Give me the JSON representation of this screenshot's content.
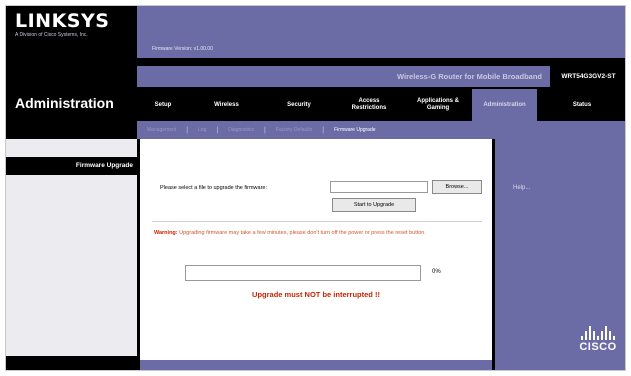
{
  "brand": {
    "logo": "LINKSYS",
    "tagline": "A Division of Cisco Systems, Inc.",
    "firmware_version": "Firmware Version: v1.00.00"
  },
  "header": {
    "product_name": "Wireless-G Router for Mobile Broadband",
    "model_number": "WRT54G3GV2-ST",
    "section_title": "Administration"
  },
  "tabs": [
    {
      "label": "Setup",
      "active": false
    },
    {
      "label": "Wireless",
      "active": false
    },
    {
      "label": "Security",
      "active": false
    },
    {
      "label": "Access Restrictions",
      "active": false
    },
    {
      "label": "Applications & Gaming",
      "active": false
    },
    {
      "label": "Administration",
      "active": true
    },
    {
      "label": "Status",
      "active": false
    }
  ],
  "subtabs": [
    {
      "label": "Management",
      "active": false
    },
    {
      "label": "Log",
      "active": false
    },
    {
      "label": "Diagnostics",
      "active": false
    },
    {
      "label": "Factory Defaults",
      "active": false
    },
    {
      "label": "Firmware Upgrade",
      "active": true
    }
  ],
  "sidebar": {
    "label": "Firmware Upgrade"
  },
  "main": {
    "prompt": "Please select a file to upgrade the firmware:",
    "file_value": "",
    "browse_label": "Browse...",
    "start_label": "Start to Upgrade",
    "warning_label": "Warning:",
    "warning_text": "Upgrading firmware may take a few minutes, please don't turn off the power or press the reset button.",
    "progress_percent": "0%",
    "progress_fraction": 0,
    "interrupt_warning": "Upgrade must NOT be interrupted !!"
  },
  "right_panel": {
    "help_label": "Help...",
    "cisco_word": "CISCO",
    "cisco_icon": "cisco-bridge-logo"
  },
  "colors": {
    "accent": "#6b6ba6",
    "band": "#000000",
    "warning": "#cc2200"
  }
}
